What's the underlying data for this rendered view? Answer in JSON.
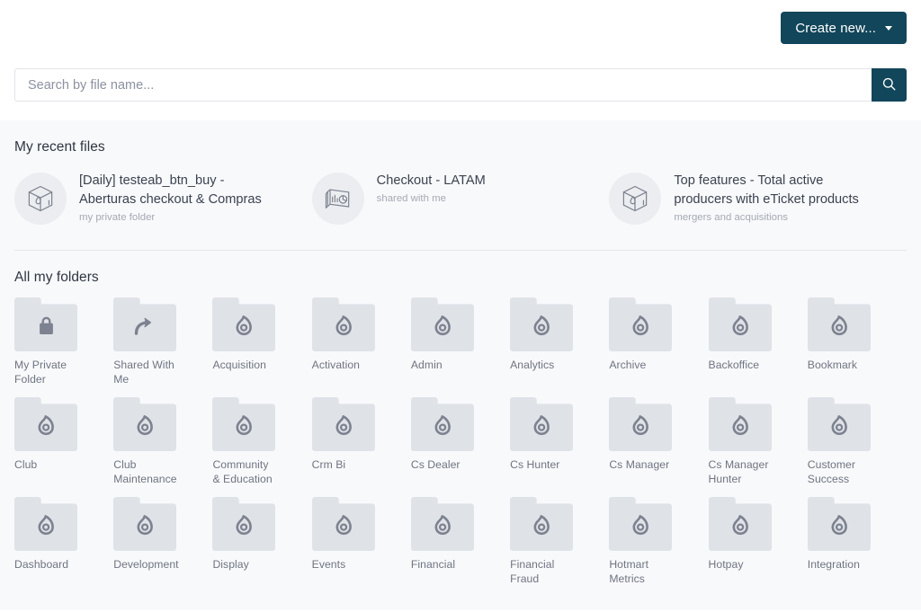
{
  "colors": {
    "accent": "#12465a",
    "panel_bg": "#f8f9fb",
    "folder_fill": "#dfe2e7",
    "folder_glyph": "#7c828f",
    "text": "#3b4250",
    "muted": "#a4a9b4"
  },
  "toolbar": {
    "create_label": "Create new...",
    "create_icon": "chevron-down-icon"
  },
  "search": {
    "placeholder": "Search by file name...",
    "value": "",
    "button_icon": "search-icon"
  },
  "recent": {
    "title": "My recent files",
    "items": [
      {
        "name": "[Daily] testeab_btn_buy - Aberturas checkout & Compras",
        "subtitle": "my private folder",
        "icon": "cube-box-icon"
      },
      {
        "name": "Checkout - LATAM",
        "subtitle": "shared with me",
        "icon": "dashboard-stack-icon"
      },
      {
        "name": "Top features - Total active producers with eTicket products",
        "subtitle": "mergers and acquisitions",
        "icon": "cube-box-icon"
      }
    ]
  },
  "folders": {
    "title": "All my folders",
    "items": [
      {
        "label": "My Private Folder",
        "icon": "lock-icon"
      },
      {
        "label": "Shared With Me",
        "icon": "share-arrow-icon"
      },
      {
        "label": "Acquisition",
        "icon": "flame-icon"
      },
      {
        "label": "Activation",
        "icon": "flame-icon"
      },
      {
        "label": "Admin",
        "icon": "flame-icon"
      },
      {
        "label": "Analytics",
        "icon": "flame-icon"
      },
      {
        "label": "Archive",
        "icon": "flame-icon"
      },
      {
        "label": "Backoffice",
        "icon": "flame-icon"
      },
      {
        "label": "Bookmark",
        "icon": "flame-icon"
      },
      {
        "label": "Club",
        "icon": "flame-icon"
      },
      {
        "label": "Club Maintenance",
        "icon": "flame-icon"
      },
      {
        "label": "Community & Education",
        "icon": "flame-icon"
      },
      {
        "label": "Crm Bi",
        "icon": "flame-icon"
      },
      {
        "label": "Cs Dealer",
        "icon": "flame-icon"
      },
      {
        "label": "Cs Hunter",
        "icon": "flame-icon"
      },
      {
        "label": "Cs Manager",
        "icon": "flame-icon"
      },
      {
        "label": "Cs Manager Hunter",
        "icon": "flame-icon"
      },
      {
        "label": "Customer Success",
        "icon": "flame-icon"
      },
      {
        "label": "Dashboard",
        "icon": "flame-icon"
      },
      {
        "label": "Development",
        "icon": "flame-icon"
      },
      {
        "label": "Display",
        "icon": "flame-icon"
      },
      {
        "label": "Events",
        "icon": "flame-icon"
      },
      {
        "label": "Financial",
        "icon": "flame-icon"
      },
      {
        "label": "Financial Fraud",
        "icon": "flame-icon"
      },
      {
        "label": "Hotmart Metrics",
        "icon": "flame-icon"
      },
      {
        "label": "Hotpay",
        "icon": "flame-icon"
      },
      {
        "label": "Integration",
        "icon": "flame-icon"
      }
    ]
  }
}
